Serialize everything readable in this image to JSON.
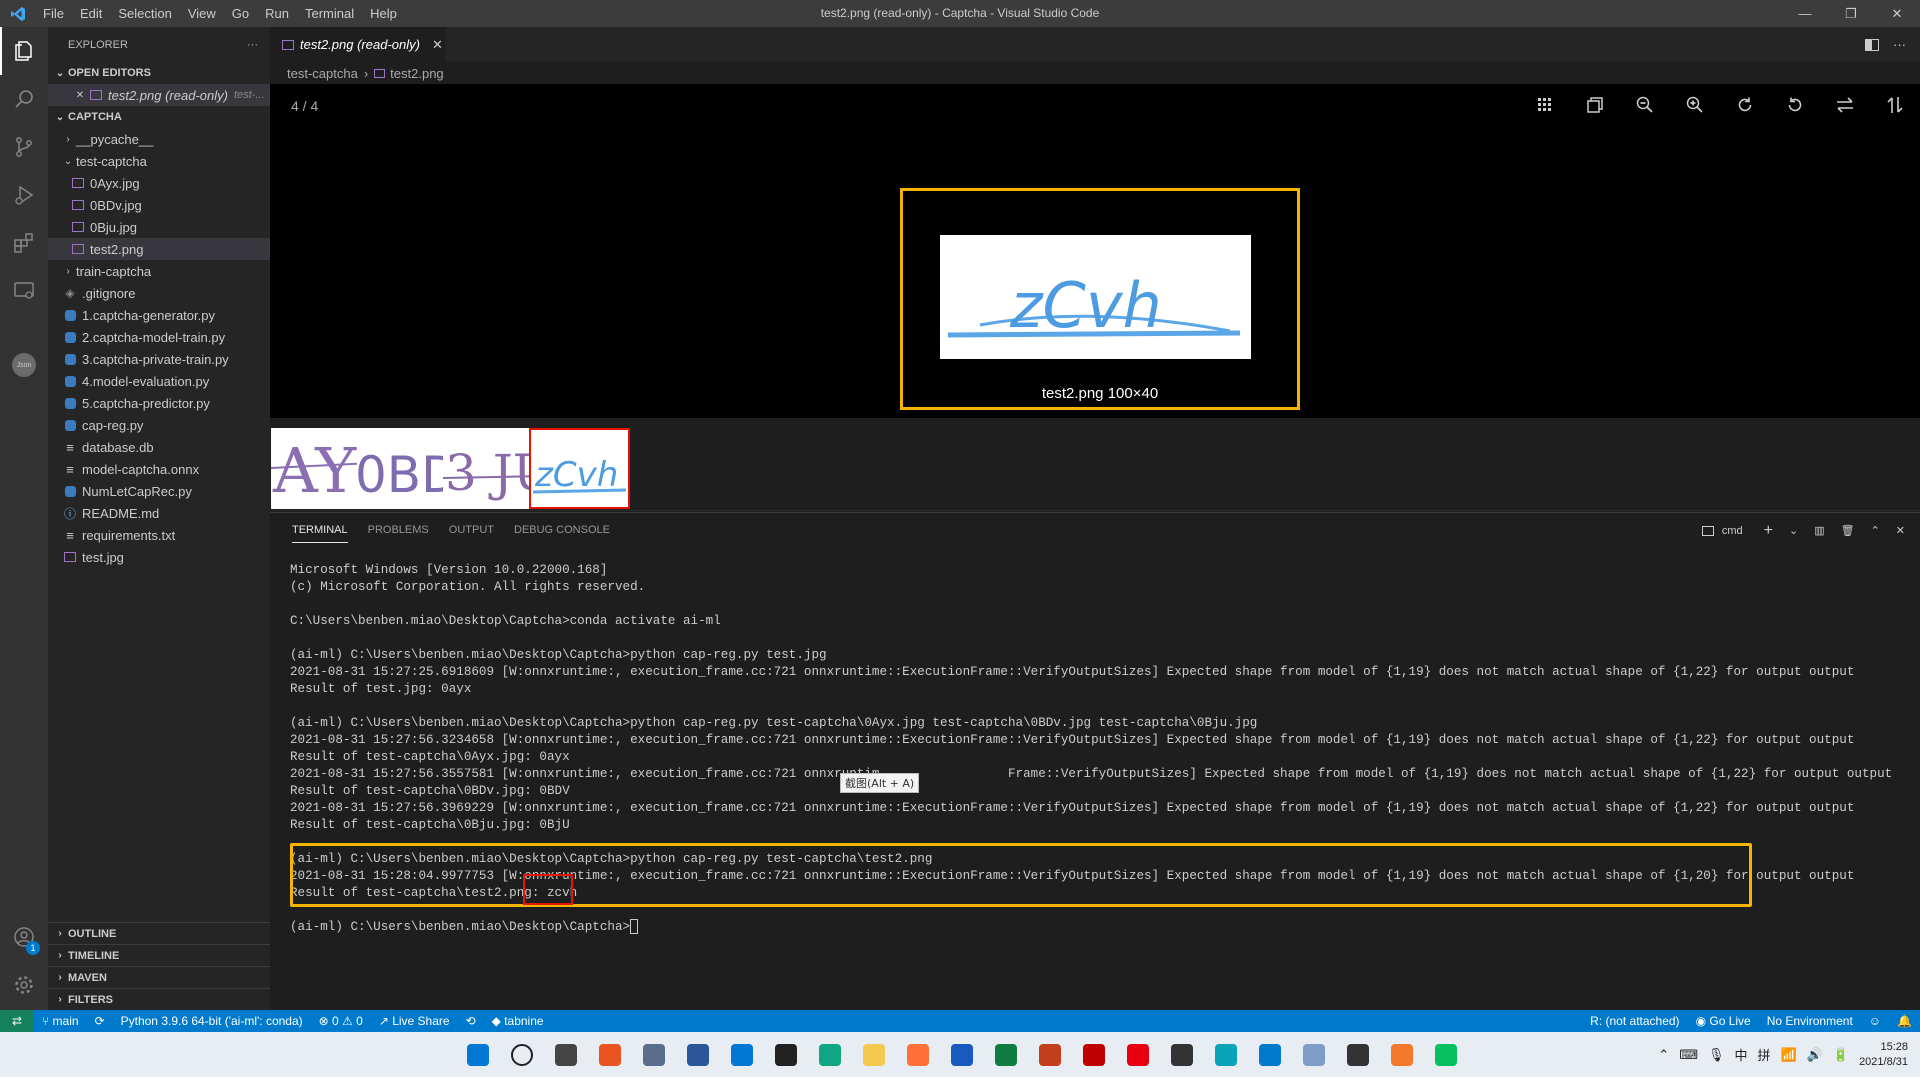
{
  "window": {
    "title": "test2.png (read-only) - Captcha - Visual Studio Code",
    "menu": [
      "File",
      "Edit",
      "Selection",
      "View",
      "Go",
      "Run",
      "Terminal",
      "Help"
    ],
    "controls": [
      "—",
      "❐",
      "✕"
    ]
  },
  "activity_bar": {
    "items": [
      "explorer-icon",
      "search-icon",
      "source-control-icon",
      "run-debug-icon",
      "extensions-icon",
      "remote-explorer-icon",
      "json-icon"
    ],
    "json_label": "Json",
    "account_badge": "1"
  },
  "sidebar": {
    "header": "EXPLORER",
    "more": "···",
    "open_editors_title": "OPEN EDITORS",
    "open_editor_item": "test2.png (read-only)",
    "open_editor_path": "test-...",
    "project_title": "CAPTCHA",
    "tree": [
      {
        "label": "__pycache__",
        "type": "folder",
        "depth": 1,
        "open": false
      },
      {
        "label": "test-captcha",
        "type": "folder",
        "depth": 1,
        "open": true
      },
      {
        "label": "0Ayx.jpg",
        "type": "image",
        "depth": 2
      },
      {
        "label": "0BDv.jpg",
        "type": "image",
        "depth": 2
      },
      {
        "label": "0Bju.jpg",
        "type": "image",
        "depth": 2
      },
      {
        "label": "test2.png",
        "type": "image",
        "depth": 2,
        "selected": true
      },
      {
        "label": "train-captcha",
        "type": "folder",
        "depth": 1,
        "open": false
      },
      {
        "label": ".gitignore",
        "type": "git",
        "depth": 1
      },
      {
        "label": "1.captcha-generator.py",
        "type": "python",
        "depth": 1
      },
      {
        "label": "2.captcha-model-train.py",
        "type": "python",
        "depth": 1
      },
      {
        "label": "3.captcha-private-train.py",
        "type": "python",
        "depth": 1
      },
      {
        "label": "4.model-evaluation.py",
        "type": "python",
        "depth": 1
      },
      {
        "label": "5.captcha-predictor.py",
        "type": "python",
        "depth": 1
      },
      {
        "label": "cap-reg.py",
        "type": "python",
        "depth": 1
      },
      {
        "label": "database.db",
        "type": "text",
        "depth": 1
      },
      {
        "label": "model-captcha.onnx",
        "type": "text",
        "depth": 1
      },
      {
        "label": "NumLetCapRec.py",
        "type": "python",
        "depth": 1
      },
      {
        "label": "README.md",
        "type": "info",
        "depth": 1
      },
      {
        "label": "requirements.txt",
        "type": "text",
        "depth": 1
      },
      {
        "label": "test.jpg",
        "type": "image",
        "depth": 1
      }
    ],
    "bottom_sections": [
      "OUTLINE",
      "TIMELINE",
      "MAVEN",
      "FILTERS"
    ]
  },
  "editor": {
    "tab_label": "test2.png (read-only)",
    "tab_close": "✕",
    "breadcrumb": [
      "test-captcha",
      "test2.png"
    ],
    "counter": "4 / 4",
    "image_caption": "test2.png 100×40",
    "captcha_text": "zCvh",
    "thumbnails": [
      "0Ayx",
      "0BDv",
      "0Bju",
      "zCvh"
    ],
    "thumb_text": [
      "AY",
      "0BDV",
      "3 JU",
      "zCvh"
    ],
    "toolbar_icons": [
      "grid-icon",
      "copy-icon",
      "zoom-out-icon",
      "zoom-in-icon",
      "rotate-right-icon",
      "rotate-left-icon",
      "flip-horizontal-icon",
      "flip-vertical-icon"
    ]
  },
  "panel": {
    "tabs": [
      "TERMINAL",
      "PROBLEMS",
      "OUTPUT",
      "DEBUG CONSOLE"
    ],
    "shell": "cmd",
    "controls": [
      "+",
      "⌄",
      "▥",
      "🗑",
      "⌃",
      "✕"
    ],
    "tooltip": "截图(Alt + A)",
    "lines": [
      "Microsoft Windows [Version 10.0.22000.168]",
      "(c) Microsoft Corporation. All rights reserved.",
      "",
      "C:\\Users\\benben.miao\\Desktop\\Captcha>conda activate ai-ml",
      "",
      "(ai-ml) C:\\Users\\benben.miao\\Desktop\\Captcha>python cap-reg.py test.jpg",
      "2021-08-31 15:27:25.6918609 [W:onnxruntime:, execution_frame.cc:721 onnxruntime::ExecutionFrame::VerifyOutputSizes] Expected shape from model of {1,19} does not match actual shape of {1,22} for output output",
      "Result of test.jpg: 0ayx",
      "",
      "(ai-ml) C:\\Users\\benben.miao\\Desktop\\Captcha>python cap-reg.py test-captcha\\0Ayx.jpg test-captcha\\0BDv.jpg test-captcha\\0Bju.jpg",
      "2021-08-31 15:27:56.3234658 [W:onnxruntime:, execution_frame.cc:721 onnxruntime::ExecutionFrame::VerifyOutputSizes] Expected shape from model of {1,19} does not match actual shape of {1,22} for output output",
      "Result of test-captcha\\0Ayx.jpg: 0ayx",
      "2021-08-31 15:27:56.3557581 [W:onnxruntime:, execution_frame.cc:721 onnxruntim                 Frame::VerifyOutputSizes] Expected shape from model of {1,19} does not match actual shape of {1,22} for output output",
      "Result of test-captcha\\0BDv.jpg: 0BDV",
      "2021-08-31 15:27:56.3969229 [W:onnxruntime:, execution_frame.cc:721 onnxruntime::ExecutionFrame::VerifyOutputSizes] Expected shape from model of {1,19} does not match actual shape of {1,22} for output output",
      "Result of test-captcha\\0Bju.jpg: 0BjU",
      "",
      "(ai-ml) C:\\Users\\benben.miao\\Desktop\\Captcha>python cap-reg.py test-captcha\\test2.png",
      "2021-08-31 15:28:04.9977753 [W:onnxruntime:, execution_frame.cc:721 onnxruntime::ExecutionFrame::VerifyOutputSizes] Expected shape from model of {1,19} does not match actual shape of {1,20} for output output",
      "Result of test-captcha\\test2.png: zcvh",
      "",
      "(ai-ml) C:\\Users\\benben.miao\\Desktop\\Captcha>"
    ]
  },
  "statusbar": {
    "remote": "⇄",
    "branch": "main",
    "python": "Python 3.9.6 64-bit ('ai-ml': conda)",
    "problems": "⊗ 0 ⚠ 0",
    "liveshare": "Live Share",
    "tabnine": "tabnine",
    "r_status": "R: (not attached)",
    "golive": "Go Live",
    "environment": "No Environment"
  },
  "taskbar": {
    "ime_zh": "中",
    "ime_pinyin": "拼",
    "time": "15:28",
    "date": "2021/8/31",
    "app_colors": [
      "#0078d4",
      "#222222",
      "#444444",
      "#e95420",
      "#5a6e8c",
      "#2b579a",
      "#0078d4",
      "#222222",
      "#11a683",
      "#f2c94c",
      "#ff7139",
      "#185abd",
      "#107c41",
      "#c43e1c",
      "#c00000",
      "#e60012",
      "#333333",
      "#0aa3b8",
      "#007acc",
      "#7f9cc8",
      "#333333",
      "#f5792a",
      "#07c160"
    ]
  }
}
